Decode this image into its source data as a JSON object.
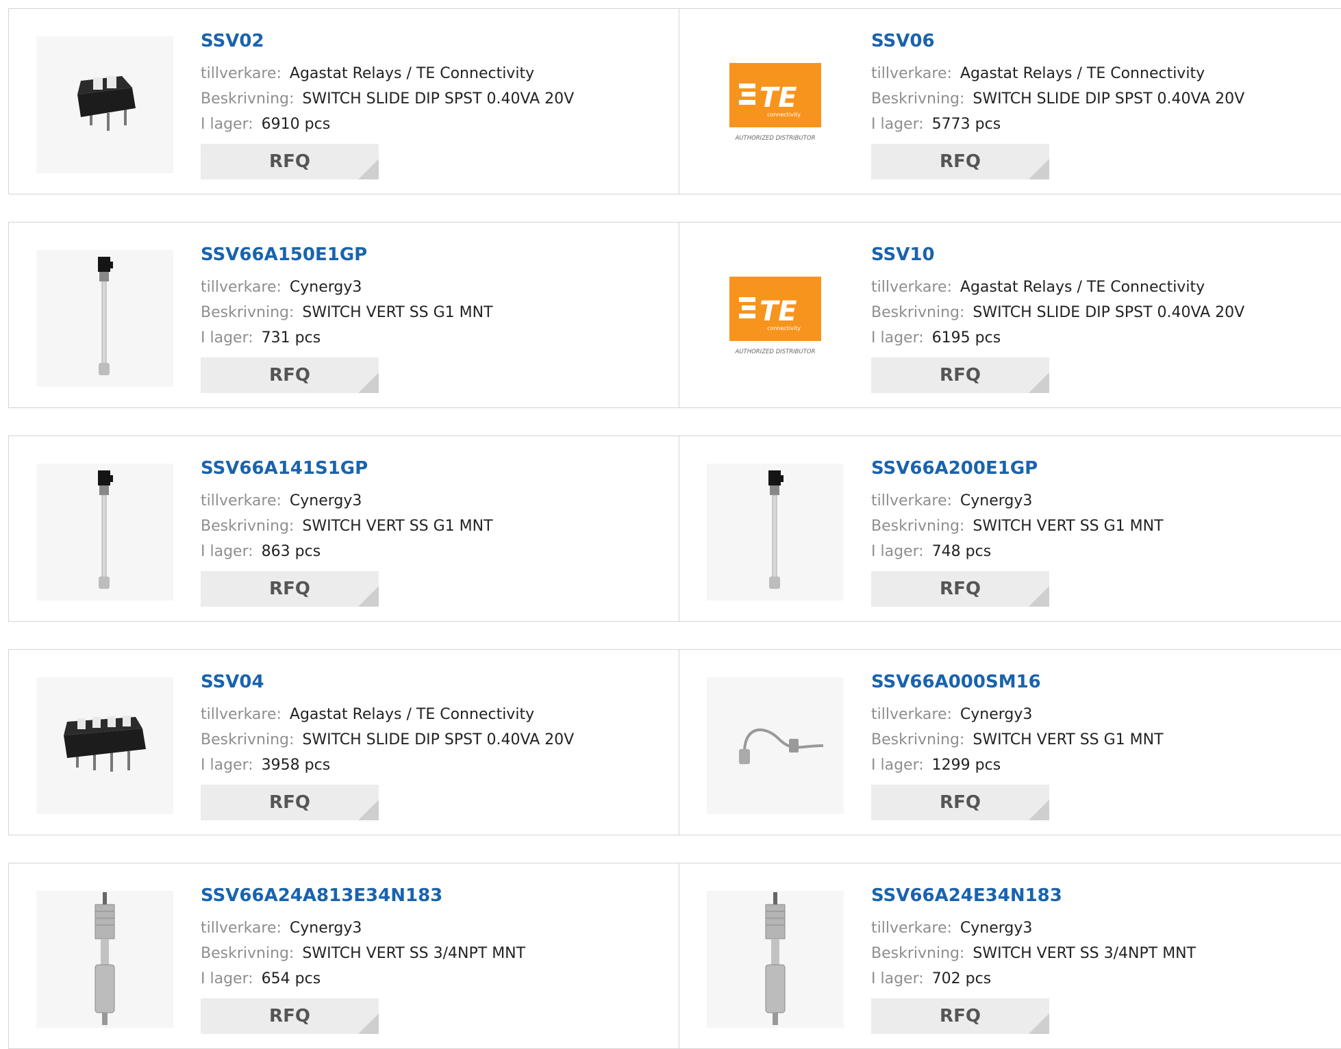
{
  "labels": {
    "manufacturer": "tillverkare:",
    "description": "Beskrivning:",
    "stock": "I lager:",
    "rfq": "RFQ"
  },
  "logo": {
    "te": "TE",
    "connectivity": "connectivity",
    "authorized": "AUTHORIZED DISTRIBUTOR",
    "brand_color": "#f7941d"
  },
  "products": [
    {
      "part": "SSV02",
      "manufacturer": "Agastat Relays / TE Connectivity",
      "description": "SWITCH SLIDE DIP SPST 0.40VA 20V",
      "stock": "6910 pcs",
      "image": "dip-switch-2pos"
    },
    {
      "part": "SSV06",
      "manufacturer": "Agastat Relays / TE Connectivity",
      "description": "SWITCH SLIDE DIP SPST 0.40VA 20V",
      "stock": "5773 pcs",
      "image": "te-logo"
    },
    {
      "part": "SSV66A150E1GP",
      "manufacturer": "Cynergy3",
      "description": "SWITCH VERT SS G1 MNT",
      "stock": "731 pcs",
      "image": "vertical-float-switch"
    },
    {
      "part": "SSV10",
      "manufacturer": "Agastat Relays / TE Connectivity",
      "description": "SWITCH SLIDE DIP SPST 0.40VA 20V",
      "stock": "6195 pcs",
      "image": "te-logo"
    },
    {
      "part": "SSV66A141S1GP",
      "manufacturer": "Cynergy3",
      "description": "SWITCH VERT SS G1 MNT",
      "stock": "863 pcs",
      "image": "vertical-float-switch"
    },
    {
      "part": "SSV66A200E1GP",
      "manufacturer": "Cynergy3",
      "description": "SWITCH VERT SS G1 MNT",
      "stock": "748 pcs",
      "image": "vertical-float-switch"
    },
    {
      "part": "SSV04",
      "manufacturer": "Agastat Relays / TE Connectivity",
      "description": "SWITCH SLIDE DIP SPST 0.40VA 20V",
      "stock": "3958 pcs",
      "image": "dip-switch-4pos"
    },
    {
      "part": "SSV66A000SM16",
      "manufacturer": "Cynergy3",
      "description": "SWITCH VERT SS G1 MNT",
      "stock": "1299 pcs",
      "image": "bent-float-switch"
    },
    {
      "part": "SSV66A24A813E34N183",
      "manufacturer": "Cynergy3",
      "description": "SWITCH VERT SS 3/4NPT MNT",
      "stock": "654 pcs",
      "image": "steel-float-switch"
    },
    {
      "part": "SSV66A24E34N183",
      "manufacturer": "Cynergy3",
      "description": "SWITCH VERT SS 3/4NPT MNT",
      "stock": "702 pcs",
      "image": "steel-float-switch"
    }
  ]
}
